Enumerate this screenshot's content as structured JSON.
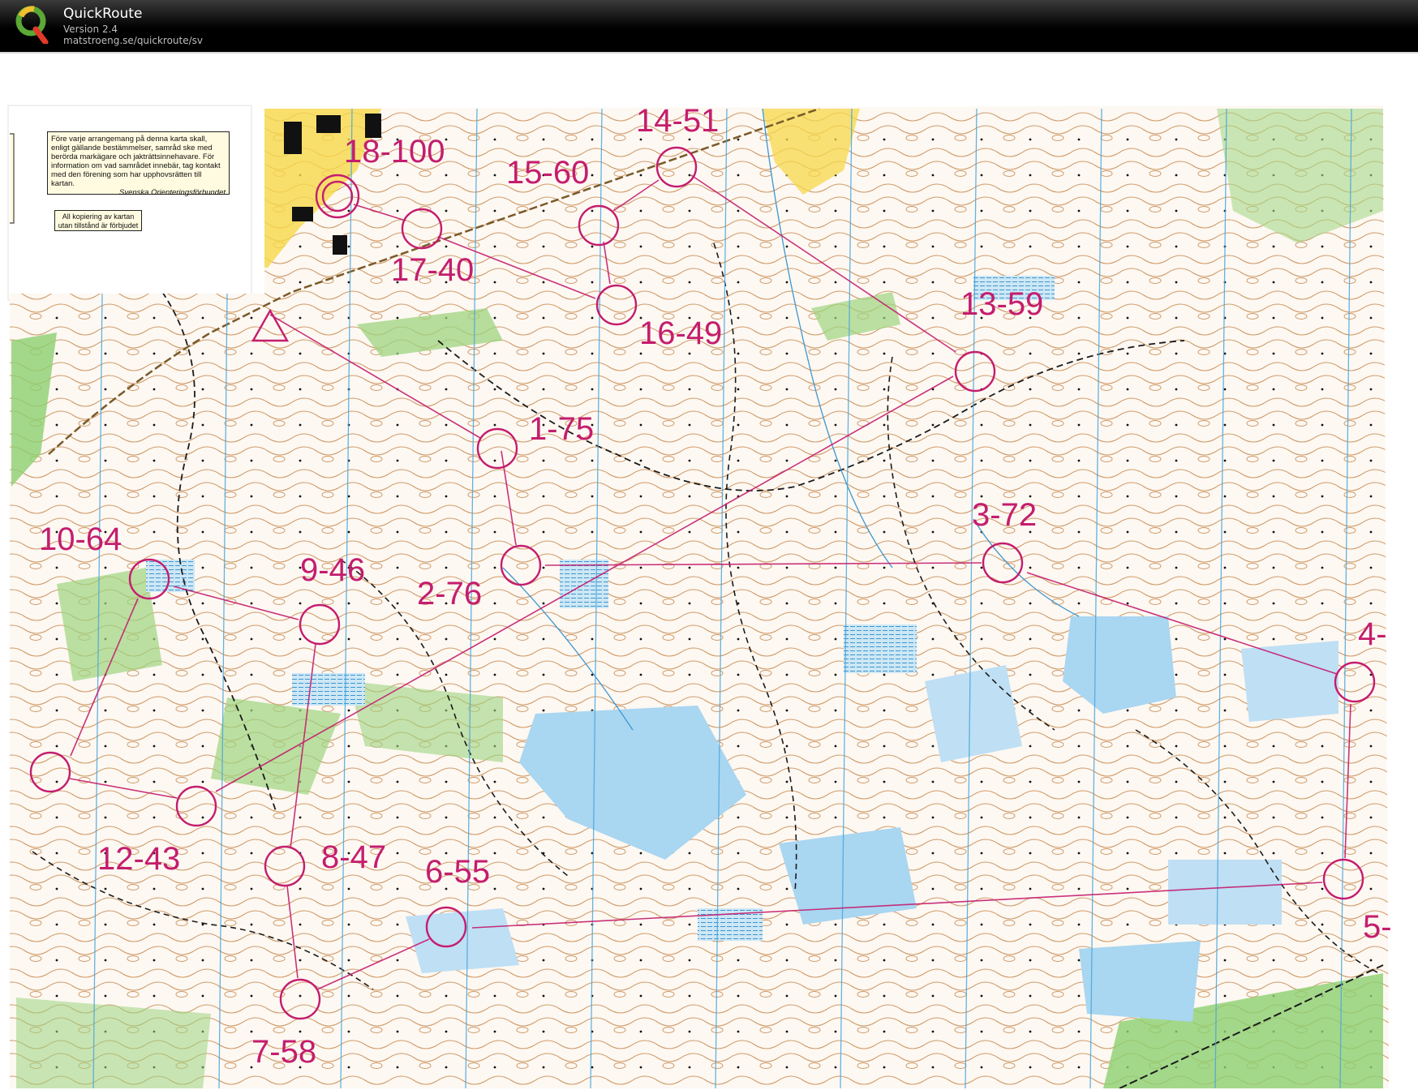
{
  "app": {
    "name": "QuickRoute",
    "version": "Version 2.4",
    "url": "matstroeng.se/quickroute/sv"
  },
  "map": {
    "notice_text": "Före varje arrangemang på denna karta skall, enligt gällande bestämmelser, samråd ske med berörda markägare och jakträttsinnehavare. För information om vad samrådet innebär, tag kontakt med den förening som har upphovsrätten till kartan.",
    "notice_signature": "Svenska Orienteringsförbundet",
    "copy_notice": "All kopiering av kartan utan tillstånd är förbjudet",
    "controls": [
      {
        "label": "1-75"
      },
      {
        "label": "2-76"
      },
      {
        "label": "3-72"
      },
      {
        "label": "4-"
      },
      {
        "label": "5-"
      },
      {
        "label": "6-55"
      },
      {
        "label": "7-58"
      },
      {
        "label": "8-47"
      },
      {
        "label": "9-46"
      },
      {
        "label": "10-64"
      },
      {
        "label": "12-43"
      },
      {
        "label": "13-59"
      },
      {
        "label": "14-51"
      },
      {
        "label": "15-60"
      },
      {
        "label": "16-49"
      },
      {
        "label": "17-40"
      },
      {
        "label": "18-100"
      }
    ],
    "colors": {
      "course": "#c41d6e",
      "contour": "#c48a55",
      "water": "#a7d3ee",
      "meridian": "#4aa6dc",
      "open_land": "#f4d23c",
      "green": "#86c66a",
      "path": "#1b1b1b"
    }
  }
}
